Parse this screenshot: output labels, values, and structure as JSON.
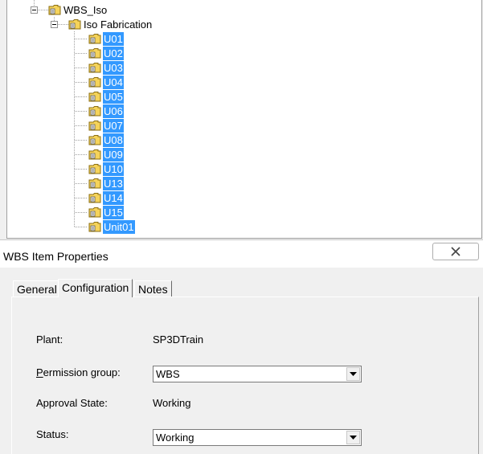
{
  "tree": {
    "root": {
      "label": "WBS_Iso"
    },
    "child": {
      "label": "Iso Fabrication"
    },
    "items": [
      {
        "label": "U01"
      },
      {
        "label": "U02"
      },
      {
        "label": "U03"
      },
      {
        "label": "U04"
      },
      {
        "label": "U05"
      },
      {
        "label": "U06"
      },
      {
        "label": "U07"
      },
      {
        "label": "U08"
      },
      {
        "label": "U09"
      },
      {
        "label": "U10"
      },
      {
        "label": "U13"
      },
      {
        "label": "U14"
      },
      {
        "label": "U15"
      },
      {
        "label": "Unit01"
      }
    ],
    "selection_color": "#3399ff",
    "folder_color": "#f5d35a"
  },
  "dialog": {
    "title": "WBS Item Properties",
    "close_icon": "close-icon",
    "tabs": [
      {
        "label": "General"
      },
      {
        "label": "Configuration"
      },
      {
        "label": "Notes"
      }
    ],
    "active_tab": "Configuration",
    "fields": {
      "plant": {
        "label": "Plant:",
        "value": "SP3DTrain"
      },
      "permission_group": {
        "label_first": "P",
        "label_rest": "ermission group:",
        "value": "WBS"
      },
      "approval_state": {
        "label": "Approval State:",
        "value": "Working"
      },
      "status": {
        "label": "Status:",
        "value": "Working"
      }
    }
  }
}
